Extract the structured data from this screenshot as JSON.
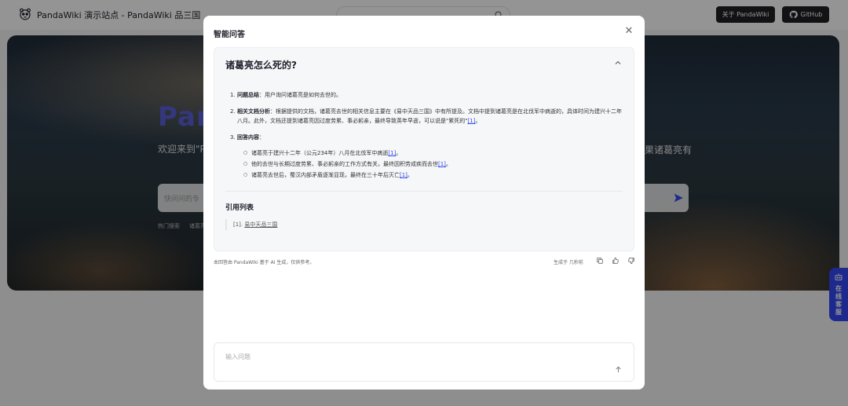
{
  "header": {
    "site_title": "PandaWiki 演示站点 - PandaWiki 品三国",
    "about_label": "关于 PandaWiki",
    "github_label": "GitHub"
  },
  "hero": {
    "title": "Pan",
    "desc_left": "欢迎来到\"P 一台能检索",
    "desc_right": "果诸葛亮有",
    "search_placeholder": "快问问的专",
    "tags": [
      "热门搜索",
      "诸葛亮"
    ]
  },
  "float": {
    "label_chars": [
      "在",
      "线",
      "客",
      "服"
    ]
  },
  "modal": {
    "title": "智能问答",
    "question": "诸葛亮怎么死的?",
    "answer": {
      "items": [
        {
          "num": "1.",
          "label": "问题总结",
          "text": "：用户询问诸葛亮是如何去世的。"
        },
        {
          "num": "2.",
          "label": "相关文档分析",
          "text": "：根据提供的文档，诸葛亮去世的相关信息主要在《易中天品三国》中有所提及。文档中提到诸葛亮是在北伐军中病逝的，具体时间为建兴十二年八月。此外，文档还提到诸葛亮因过度劳累、事必躬亲，最终导致英年早逝，可以说是\"累死的\"",
          "ref": "[1]",
          "tail": "。"
        },
        {
          "num": "3.",
          "label": "回答内容",
          "text": "："
        }
      ],
      "bullets": [
        {
          "text": "诸葛亮于建兴十二年（公元234年）八月在北伐军中病逝",
          "ref": "[1]",
          "tail": "。"
        },
        {
          "text": "他的去世与长期过度劳累、事必躬亲的工作方式有关，最终因积劳成疾而去世",
          "ref": "[1]",
          "tail": "。"
        },
        {
          "text": "诸葛亮去世后，蜀汉内部矛盾逐渐显现，最终在三十年后灭亡",
          "ref": "[1]",
          "tail": "。"
        }
      ]
    },
    "citations": {
      "title": "引用列表",
      "items": [
        {
          "index": "[1].",
          "text": "易中天品三国"
        }
      ]
    },
    "disclaimer": "本回答由 PandaWiki 基于 AI 生成，仅供参考。",
    "generated_at": "生成于 几秒前",
    "input_placeholder": "输入问题"
  }
}
